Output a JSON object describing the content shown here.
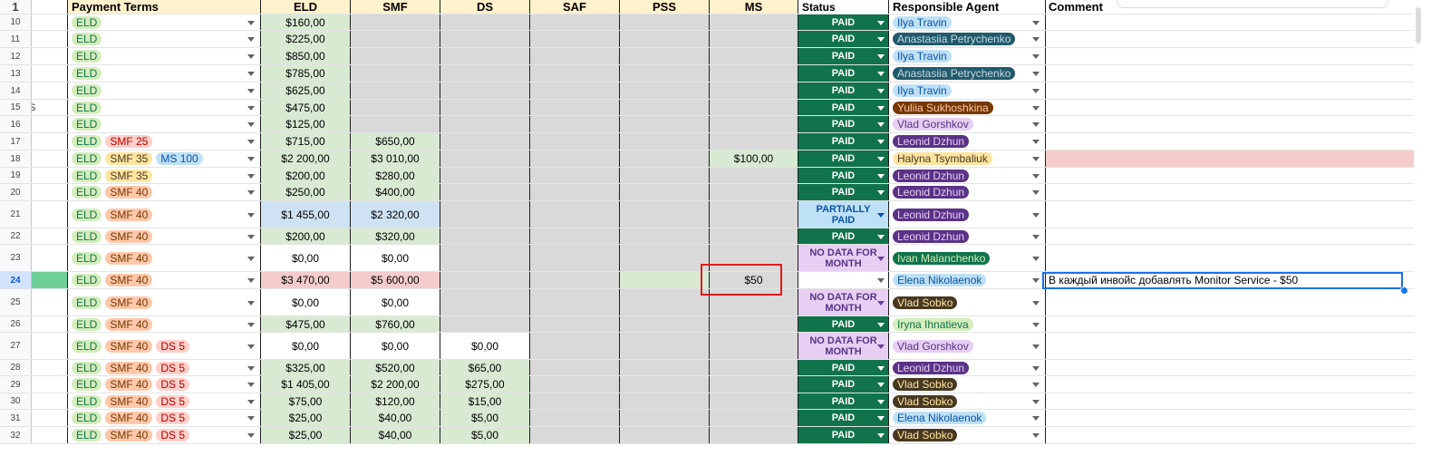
{
  "header": {
    "row_num": "1",
    "payment_terms": "Payment Terms",
    "eld": "ELD",
    "smf": "SMF",
    "ds": "DS",
    "saf": "SAF",
    "pss": "PSS",
    "ms": "MS",
    "status": "Status",
    "agent": "Responsible Agent",
    "comment": "Comment"
  },
  "rows": [
    {
      "n": "10",
      "h": 18,
      "terms": [
        [
          "ELD",
          "eld"
        ]
      ],
      "eld": [
        "$160,00",
        "g"
      ],
      "smf": [
        "",
        "gray"
      ],
      "ds": [
        "",
        "gray"
      ],
      "saf": [
        "",
        "gray"
      ],
      "pss": [
        "",
        "gray"
      ],
      "ms": [
        "",
        "gray"
      ],
      "status": [
        "PAID",
        "paid"
      ],
      "agent": [
        "Ilya Travin",
        "ilya"
      ],
      "comment": ""
    },
    {
      "n": "11",
      "h": 19,
      "terms": [
        [
          "ELD",
          "eld"
        ]
      ],
      "eld": [
        "$225,00",
        "g"
      ],
      "smf": [
        "",
        "gray"
      ],
      "ds": [
        "",
        "gray"
      ],
      "saf": [
        "",
        "gray"
      ],
      "pss": [
        "",
        "gray"
      ],
      "ms": [
        "",
        "gray"
      ],
      "status": [
        "PAID",
        "paid"
      ],
      "agent": [
        "Anastasiia Petrychenko",
        "anast"
      ],
      "comment": ""
    },
    {
      "n": "12",
      "h": 19,
      "terms": [
        [
          "ELD",
          "eld"
        ]
      ],
      "eld": [
        "$850,00",
        "g"
      ],
      "smf": [
        "",
        "gray"
      ],
      "ds": [
        "",
        "gray"
      ],
      "saf": [
        "",
        "gray"
      ],
      "pss": [
        "",
        "gray"
      ],
      "ms": [
        "",
        "gray"
      ],
      "status": [
        "PAID",
        "paid"
      ],
      "agent": [
        "Ilya Travin",
        "ilya"
      ],
      "comment": ""
    },
    {
      "n": "13",
      "h": 19,
      "terms": [
        [
          "ELD",
          "eld"
        ]
      ],
      "eld": [
        "$785,00",
        "g"
      ],
      "smf": [
        "",
        "gray"
      ],
      "ds": [
        "",
        "gray"
      ],
      "saf": [
        "",
        "gray"
      ],
      "pss": [
        "",
        "gray"
      ],
      "ms": [
        "",
        "gray"
      ],
      "status": [
        "PAID",
        "paid"
      ],
      "agent": [
        "Anastasiia Petrychenko",
        "anast"
      ],
      "comment": ""
    },
    {
      "n": "14",
      "h": 19,
      "terms": [
        [
          "ELD",
          "eld"
        ]
      ],
      "eld": [
        "$625,00",
        "g"
      ],
      "smf": [
        "",
        "gray"
      ],
      "ds": [
        "",
        "gray"
      ],
      "saf": [
        "",
        "gray"
      ],
      "pss": [
        "",
        "gray"
      ],
      "ms": [
        "",
        "gray"
      ],
      "status": [
        "PAID",
        "paid"
      ],
      "agent": [
        "Ilya Travin",
        "ilya"
      ],
      "comment": ""
    },
    {
      "n": "15",
      "h": 18,
      "frag": "S",
      "terms": [
        [
          "ELD",
          "eld"
        ]
      ],
      "eld": [
        "$475,00",
        "g"
      ],
      "smf": [
        "",
        "gray"
      ],
      "ds": [
        "",
        "gray"
      ],
      "saf": [
        "",
        "gray"
      ],
      "pss": [
        "",
        "gray"
      ],
      "ms": [
        "",
        "gray"
      ],
      "status": [
        "PAID",
        "paid"
      ],
      "agent": [
        "Yuliia Sukhoshkina",
        "yuliia"
      ],
      "comment": ""
    },
    {
      "n": "16",
      "h": 19,
      "terms": [
        [
          "ELD",
          "eld"
        ]
      ],
      "eld": [
        "$125,00",
        "g"
      ],
      "smf": [
        "",
        "gray"
      ],
      "ds": [
        "",
        "gray"
      ],
      "saf": [
        "",
        "gray"
      ],
      "pss": [
        "",
        "gray"
      ],
      "ms": [
        "",
        "gray"
      ],
      "status": [
        "PAID",
        "paid"
      ],
      "agent": [
        "Vlad Gorshkov",
        "vladg"
      ],
      "comment": ""
    },
    {
      "n": "17",
      "h": 19,
      "terms": [
        [
          "ELD",
          "eld"
        ],
        [
          "SMF 25",
          "smf"
        ]
      ],
      "eld": [
        "$715,00",
        "g"
      ],
      "smf": [
        "$650,00",
        "g"
      ],
      "ds": [
        "",
        "gray"
      ],
      "saf": [
        "",
        "gray"
      ],
      "pss": [
        "",
        "gray"
      ],
      "ms": [
        "",
        "gray"
      ],
      "status": [
        "PAID",
        "paid"
      ],
      "agent": [
        "Leonid Dzhun",
        "leonid"
      ],
      "comment": ""
    },
    {
      "n": "18",
      "h": 19,
      "terms": [
        [
          "ELD",
          "eld"
        ],
        [
          "SMF 35",
          "smf-y"
        ],
        [
          "MS 100",
          "ms-l"
        ]
      ],
      "eld": [
        "$2 200,00",
        "g"
      ],
      "smf": [
        "$3 010,00",
        "g"
      ],
      "ds": [
        "",
        "gray"
      ],
      "saf": [
        "",
        "gray"
      ],
      "pss": [
        "",
        "gray"
      ],
      "ms": [
        "$100,00",
        "g"
      ],
      "status": [
        "PAID",
        "paid"
      ],
      "agent": [
        "Halyna Tsymbaliuk",
        "halyna"
      ],
      "comment": "",
      "commentbg": "pink"
    },
    {
      "n": "19",
      "h": 18,
      "terms": [
        [
          "ELD",
          "eld"
        ],
        [
          "SMF 35",
          "smf-y"
        ]
      ],
      "eld": [
        "$200,00",
        "g"
      ],
      "smf": [
        "$280,00",
        "g"
      ],
      "ds": [
        "",
        "gray"
      ],
      "saf": [
        "",
        "gray"
      ],
      "pss": [
        "",
        "gray"
      ],
      "ms": [
        "",
        "gray"
      ],
      "status": [
        "PAID",
        "paid"
      ],
      "agent": [
        "Leonid Dzhun",
        "leonid"
      ],
      "comment": ""
    },
    {
      "n": "20",
      "h": 19,
      "terms": [
        [
          "ELD",
          "eld"
        ],
        [
          "SMF 40",
          "smf-o"
        ]
      ],
      "eld": [
        "$250,00",
        "g"
      ],
      "smf": [
        "$400,00",
        "g"
      ],
      "ds": [
        "",
        "gray"
      ],
      "saf": [
        "",
        "gray"
      ],
      "pss": [
        "",
        "gray"
      ],
      "ms": [
        "",
        "gray"
      ],
      "status": [
        "PAID",
        "paid"
      ],
      "agent": [
        "Leonid Dzhun",
        "leonid"
      ],
      "comment": ""
    },
    {
      "n": "21",
      "h": 30,
      "terms": [
        [
          "ELD",
          "eld"
        ],
        [
          "SMF 40",
          "smf-o"
        ]
      ],
      "eld": [
        "$1 455,00",
        "blue"
      ],
      "smf": [
        "$2 320,00",
        "blue"
      ],
      "ds": [
        "",
        "gray"
      ],
      "saf": [
        "",
        "gray"
      ],
      "pss": [
        "",
        "gray"
      ],
      "ms": [
        "",
        "gray"
      ],
      "status": [
        "PARTIALLY PAID",
        "pp"
      ],
      "agent": [
        "Leonid Dzhun",
        "leonid"
      ],
      "comment": ""
    },
    {
      "n": "22",
      "h": 18,
      "terms": [
        [
          "ELD",
          "eld"
        ],
        [
          "SMF 40",
          "smf-o"
        ]
      ],
      "eld": [
        "$200,00",
        "g"
      ],
      "smf": [
        "$320,00",
        "g"
      ],
      "ds": [
        "",
        "gray"
      ],
      "saf": [
        "",
        "gray"
      ],
      "pss": [
        "",
        "gray"
      ],
      "ms": [
        "",
        "gray"
      ],
      "status": [
        "PAID",
        "paid"
      ],
      "agent": [
        "Leonid Dzhun",
        "leonid"
      ],
      "comment": ""
    },
    {
      "n": "23",
      "h": 30,
      "terms": [
        [
          "ELD",
          "eld"
        ],
        [
          "SMF 40",
          "smf-o"
        ]
      ],
      "eld": [
        "$0,00",
        "white"
      ],
      "smf": [
        "$0,00",
        "white"
      ],
      "ds": [
        "",
        "gray"
      ],
      "saf": [
        "",
        "gray"
      ],
      "pss": [
        "",
        "gray"
      ],
      "ms": [
        "",
        "gray"
      ],
      "status": [
        "NO DATA FOR MONTH",
        "nd"
      ],
      "agent": [
        "Ivan Malanchenko",
        "ivan"
      ],
      "comment": ""
    },
    {
      "n": "24",
      "h": 19,
      "sel": true,
      "terms": [
        [
          "ELD",
          "eld"
        ],
        [
          "SMF 40",
          "smf-o"
        ]
      ],
      "eld": [
        "$3 470,00",
        "pink"
      ],
      "smf": [
        "$5 600,00",
        "pink"
      ],
      "ds": [
        "",
        "gray"
      ],
      "saf": [
        "",
        "gray"
      ],
      "pss": [
        "",
        "lt-green"
      ],
      "ms": [
        "$50",
        "gray"
      ],
      "status": [
        "",
        "empty"
      ],
      "agent": [
        "Elena Nikolaenok",
        "elena"
      ],
      "comment": "В каждый инвойс добавлять Monitor Service - $50"
    },
    {
      "n": "25",
      "h": 30,
      "terms": [
        [
          "ELD",
          "eld"
        ],
        [
          "SMF 40",
          "smf-o"
        ]
      ],
      "eld": [
        "$0,00",
        "white"
      ],
      "smf": [
        "$0,00",
        "white"
      ],
      "ds": [
        "",
        "gray"
      ],
      "saf": [
        "",
        "gray"
      ],
      "pss": [
        "",
        "gray"
      ],
      "ms": [
        "",
        "gray"
      ],
      "status": [
        "NO DATA FOR MONTH",
        "nd"
      ],
      "agent": [
        "Vlad Sobko",
        "vlads"
      ],
      "comment": ""
    },
    {
      "n": "26",
      "h": 18,
      "terms": [
        [
          "ELD",
          "eld"
        ],
        [
          "SMF 40",
          "smf-o"
        ]
      ],
      "eld": [
        "$475,00",
        "g"
      ],
      "smf": [
        "$760,00",
        "g"
      ],
      "ds": [
        "",
        "gray"
      ],
      "saf": [
        "",
        "gray"
      ],
      "pss": [
        "",
        "gray"
      ],
      "ms": [
        "",
        "gray"
      ],
      "status": [
        "PAID",
        "paid"
      ],
      "agent": [
        "Iryna Ihnatieva",
        "iryna"
      ],
      "comment": ""
    },
    {
      "n": "27",
      "h": 30,
      "terms": [
        [
          "ELD",
          "eld"
        ],
        [
          "SMF 40",
          "smf-o"
        ],
        [
          "DS 5",
          "ds"
        ]
      ],
      "eld": [
        "$0,00",
        "white"
      ],
      "smf": [
        "$0,00",
        "white"
      ],
      "ds": [
        "$0,00",
        "white"
      ],
      "saf": [
        "",
        "gray"
      ],
      "pss": [
        "",
        "gray"
      ],
      "ms": [
        "",
        "gray"
      ],
      "status": [
        "NO DATA FOR MONTH",
        "nd"
      ],
      "agent": [
        "Vlad Gorshkov",
        "vladg"
      ],
      "comment": ""
    },
    {
      "n": "28",
      "h": 18,
      "terms": [
        [
          "ELD",
          "eld"
        ],
        [
          "SMF 40",
          "smf-o"
        ],
        [
          "DS 5",
          "ds"
        ]
      ],
      "eld": [
        "$325,00",
        "g"
      ],
      "smf": [
        "$520,00",
        "g"
      ],
      "ds": [
        "$65,00",
        "g"
      ],
      "saf": [
        "",
        "gray"
      ],
      "pss": [
        "",
        "gray"
      ],
      "ms": [
        "",
        "gray"
      ],
      "status": [
        "PAID",
        "paid"
      ],
      "agent": [
        "Leonid Dzhun",
        "leonid"
      ],
      "comment": ""
    },
    {
      "n": "29",
      "h": 19,
      "terms": [
        [
          "ELD",
          "eld"
        ],
        [
          "SMF 40",
          "smf-o"
        ],
        [
          "DS 5",
          "ds"
        ]
      ],
      "eld": [
        "$1 405,00",
        "g"
      ],
      "smf": [
        "$2 200,00",
        "g"
      ],
      "ds": [
        "$275,00",
        "g"
      ],
      "saf": [
        "",
        "gray"
      ],
      "pss": [
        "",
        "gray"
      ],
      "ms": [
        "",
        "gray"
      ],
      "status": [
        "PAID",
        "paid"
      ],
      "agent": [
        "Vlad Sobko",
        "vlads"
      ],
      "comment": ""
    },
    {
      "n": "30",
      "h": 18,
      "terms": [
        [
          "ELD",
          "eld"
        ],
        [
          "SMF 40",
          "smf-o"
        ],
        [
          "DS 5",
          "ds"
        ]
      ],
      "eld": [
        "$75,00",
        "g"
      ],
      "smf": [
        "$120,00",
        "g"
      ],
      "ds": [
        "$15,00",
        "g"
      ],
      "saf": [
        "",
        "gray"
      ],
      "pss": [
        "",
        "gray"
      ],
      "ms": [
        "",
        "gray"
      ],
      "status": [
        "PAID",
        "paid"
      ],
      "agent": [
        "Vlad Sobko",
        "vlads"
      ],
      "comment": ""
    },
    {
      "n": "31",
      "h": 19,
      "terms": [
        [
          "ELD",
          "eld"
        ],
        [
          "SMF 40",
          "smf-o"
        ],
        [
          "DS 5",
          "ds"
        ]
      ],
      "eld": [
        "$25,00",
        "g"
      ],
      "smf": [
        "$40,00",
        "g"
      ],
      "ds": [
        "$5,00",
        "g"
      ],
      "saf": [
        "",
        "gray"
      ],
      "pss": [
        "",
        "gray"
      ],
      "ms": [
        "",
        "gray"
      ],
      "status": [
        "PAID",
        "paid"
      ],
      "agent": [
        "Elena Nikolaenok",
        "elena"
      ],
      "comment": ""
    },
    {
      "n": "32",
      "h": 19,
      "terms": [
        [
          "ELD",
          "eld"
        ],
        [
          "SMF 40",
          "smf-o"
        ],
        [
          "DS 5",
          "ds"
        ]
      ],
      "eld": [
        "$25,00",
        "g"
      ],
      "smf": [
        "$40,00",
        "g"
      ],
      "ds": [
        "$5,00",
        "g"
      ],
      "saf": [
        "",
        "gray"
      ],
      "pss": [
        "",
        "gray"
      ],
      "ms": [
        "",
        "gray"
      ],
      "status": [
        "PAID",
        "paid"
      ],
      "agent": [
        "Vlad Sobko",
        "vlads"
      ],
      "comment": ""
    }
  ],
  "colors": {
    "paid_green": "#11734b",
    "highlight_red": "#e01b1b",
    "selection_blue": "#1a73e8"
  }
}
